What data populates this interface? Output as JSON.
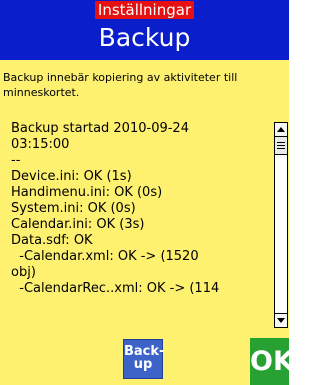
{
  "header": {
    "breadcrumb": "Inställningar",
    "title": "Backup"
  },
  "description": "Backup innebär kopiering av aktiviteter till minneskortet.",
  "log_lines": [
    "Backup startad 2010-09-24",
    "03:15:00",
    "--",
    "Device.ini: OK (1s)",
    "Handimenu.ini: OK (0s)",
    "System.ini: OK (0s)",
    "Calendar.ini: OK (3s)",
    "Data.sdf: OK",
    "  -Calendar.xml: OK -> (1520",
    "obj)",
    "  -CalendarRec..xml: OK -> (114"
  ],
  "buttons": {
    "backup_line1": "Back-",
    "backup_line2": "up",
    "ok": "OK"
  },
  "colors": {
    "background": "#fef170",
    "header": "#0a1ecc",
    "breadcrumb": "#e61010",
    "backup_button": "#3d63c8",
    "ok_button": "#27a132"
  }
}
